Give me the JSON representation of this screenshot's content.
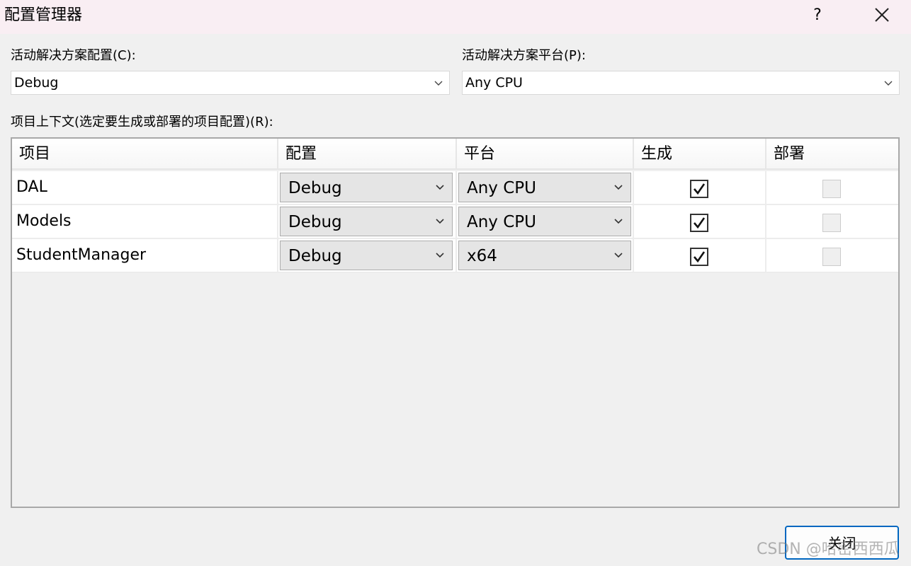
{
  "window": {
    "title": "配置管理器",
    "help_label": "?",
    "close_icon": "close-icon"
  },
  "solution_config": {
    "label": "活动解决方案配置(C):",
    "value": "Debug"
  },
  "solution_platform": {
    "label": "活动解决方案平台(P):",
    "value": "Any CPU"
  },
  "project_context": {
    "label": "项目上下文(选定要生成或部署的项目配置)(R):",
    "columns": [
      "项目",
      "配置",
      "平台",
      "生成",
      "部署"
    ],
    "rows": [
      {
        "project": "DAL",
        "config": "Debug",
        "platform": "Any CPU",
        "build": true,
        "deploy": false
      },
      {
        "project": "Models",
        "config": "Debug",
        "platform": "Any CPU",
        "build": true,
        "deploy": false
      },
      {
        "project": "StudentManager",
        "config": "Debug",
        "platform": "x64",
        "build": true,
        "deploy": false
      }
    ]
  },
  "footer": {
    "close_label": "关闭"
  },
  "watermark": "CSDN @哈密西西瓜",
  "colors": {
    "titlebar": "#f9eef3",
    "accent_border": "#0067c0",
    "dialog_bg": "#f0f0f0"
  }
}
